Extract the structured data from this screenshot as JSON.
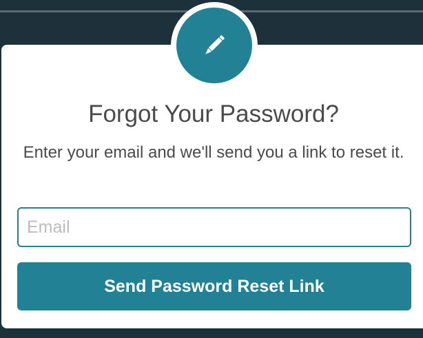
{
  "header_icon": {
    "name": "pencil-icon",
    "circle_color": "#238196",
    "glyph_color": "#ffffff"
  },
  "dialog": {
    "title": "Forgot Your Password?",
    "subtitle": "Enter your email and we'll send you a link to reset it."
  },
  "form": {
    "email": {
      "placeholder": "Email",
      "value": ""
    },
    "submit_label": "Send Password Reset Link"
  },
  "colors": {
    "background": "#1c313a",
    "accent": "#238196",
    "text": "#4a4a4a",
    "placeholder": "#bcbcbc"
  }
}
